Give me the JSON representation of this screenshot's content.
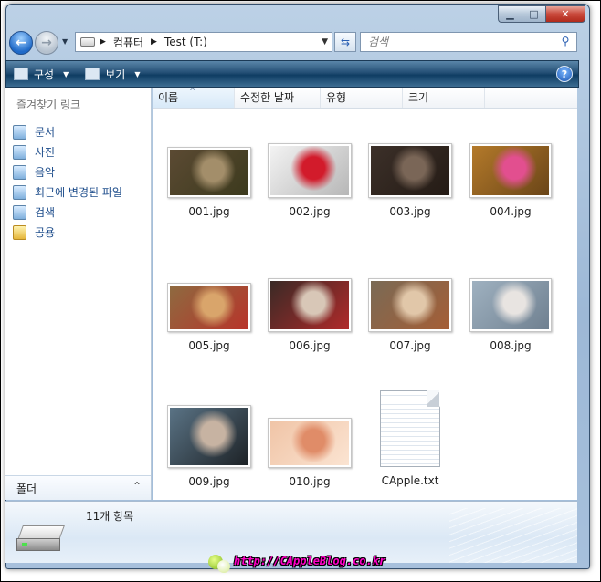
{
  "address": {
    "crumbs": [
      "컴퓨터",
      "Test (T:)"
    ]
  },
  "search": {
    "placeholder": "검색"
  },
  "toolbar": {
    "organize": "구성",
    "views": "보기"
  },
  "nav": {
    "title": "즐겨찾기 링크",
    "favorites": [
      {
        "label": "문서",
        "icon": "documents-icon"
      },
      {
        "label": "사진",
        "icon": "pictures-icon"
      },
      {
        "label": "음악",
        "icon": "music-icon"
      },
      {
        "label": "최근에 변경된 파일",
        "icon": "recent-icon"
      },
      {
        "label": "검색",
        "icon": "search-folder-icon"
      },
      {
        "label": "공용",
        "icon": "public-folder-icon"
      }
    ],
    "folders_label": "폴더"
  },
  "columns": [
    "이름",
    "수정한 날짜",
    "유형",
    "크기"
  ],
  "files": [
    {
      "name": "001.jpg",
      "colors": [
        "#5b4a33",
        "#a38e6a",
        "#3c3a1d"
      ]
    },
    {
      "name": "002.jpg",
      "colors": [
        "#f3f3f3",
        "#d21b2b",
        "#b7b7b7"
      ]
    },
    {
      "name": "003.jpg",
      "colors": [
        "#3c3029",
        "#7a6657",
        "#241b15"
      ]
    },
    {
      "name": "004.jpg",
      "colors": [
        "#b47a2a",
        "#e24f8f",
        "#6a4518"
      ]
    },
    {
      "name": "005.jpg",
      "colors": [
        "#8e6a40",
        "#d9a56b",
        "#b8342a"
      ]
    },
    {
      "name": "006.jpg",
      "colors": [
        "#3a2a26",
        "#d8c7b7",
        "#b02a2a"
      ]
    },
    {
      "name": "007.jpg",
      "colors": [
        "#7a6a55",
        "#e1c7a9",
        "#a55e36"
      ]
    },
    {
      "name": "008.jpg",
      "colors": [
        "#9fb1c0",
        "#e8e4e1",
        "#6f8090"
      ]
    },
    {
      "name": "009.jpg",
      "colors": [
        "#5a7385",
        "#c7b3a2",
        "#1d2226"
      ]
    },
    {
      "name": "010.jpg",
      "colors": [
        "#f0c4a6",
        "#e08c68",
        "#fbe4d2"
      ]
    },
    {
      "name": "CApple.txt",
      "colors": []
    }
  ],
  "details": {
    "count": "11개 항목"
  },
  "watermark": {
    "url": "http://CAppleBlog.co.kr"
  }
}
